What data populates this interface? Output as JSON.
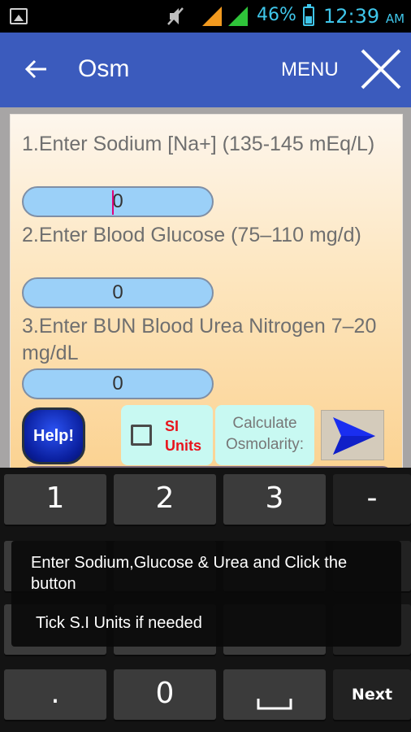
{
  "status_bar": {
    "battery_percent": "46%",
    "time": "12:39",
    "ampm": "AM",
    "icons": [
      "image-icon",
      "mute-icon",
      "signal-icon",
      "signal-icon",
      "battery-icon"
    ]
  },
  "app_bar": {
    "title": "Osm",
    "menu_label": "MENU"
  },
  "form": {
    "sodium_label": "1.Enter Sodium [Na+] (135-145 mEq/L)",
    "sodium_value": "0",
    "glucose_label": "2.Enter Blood Glucose (75–110 mg/d)",
    "glucose_value": "0",
    "bun_label": "3.Enter BUN Blood Urea Nitrogen 7–20 mg/dL",
    "bun_value": "0",
    "help_label": "Help!",
    "si_units_label": "SI Units",
    "calculate_label": "Calculate Osmolarity:"
  },
  "keyboard": {
    "keys_row1": [
      "1",
      "2",
      "3",
      "-"
    ],
    "keys_row4": [
      ".",
      "0",
      "",
      "Next"
    ]
  },
  "toast": {
    "line1": "Enter Sodium,Glucose & Urea and Click the button",
    "line2": "Tick S.I Units if needed"
  },
  "colors": {
    "app_bar": "#3b5bbd",
    "field_fill": "#9bd0f8",
    "si_text": "#e8141c",
    "status_text": "#3fc6ea"
  }
}
